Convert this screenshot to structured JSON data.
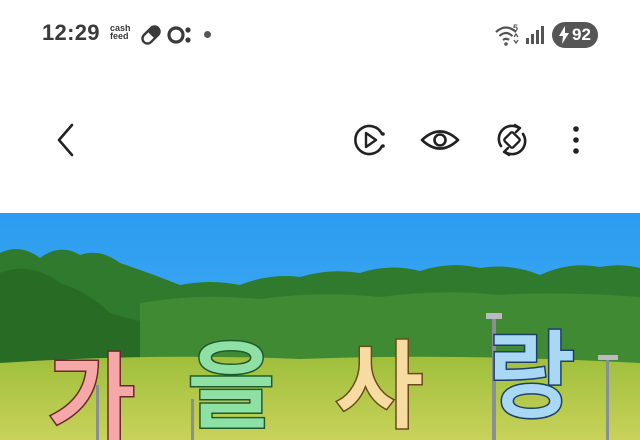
{
  "status_bar": {
    "time": "12:29",
    "cashfeed_line1": "cash",
    "cashfeed_line2": "feed",
    "wifi_badge": "5",
    "battery_level": "92",
    "battery_color": "#555555"
  },
  "toolbar": {
    "back_icon": "chevron-left-icon",
    "actions": [
      "play-circle-icon",
      "eye-icon",
      "rotate-icon",
      "more-vertical-icon"
    ]
  },
  "media": {
    "title_chars": [
      "가",
      "을",
      "사",
      "랑"
    ],
    "sky_color": "#2b9cf0",
    "forest_color": "#2f7a2c",
    "field_color": "#b7c94a"
  }
}
